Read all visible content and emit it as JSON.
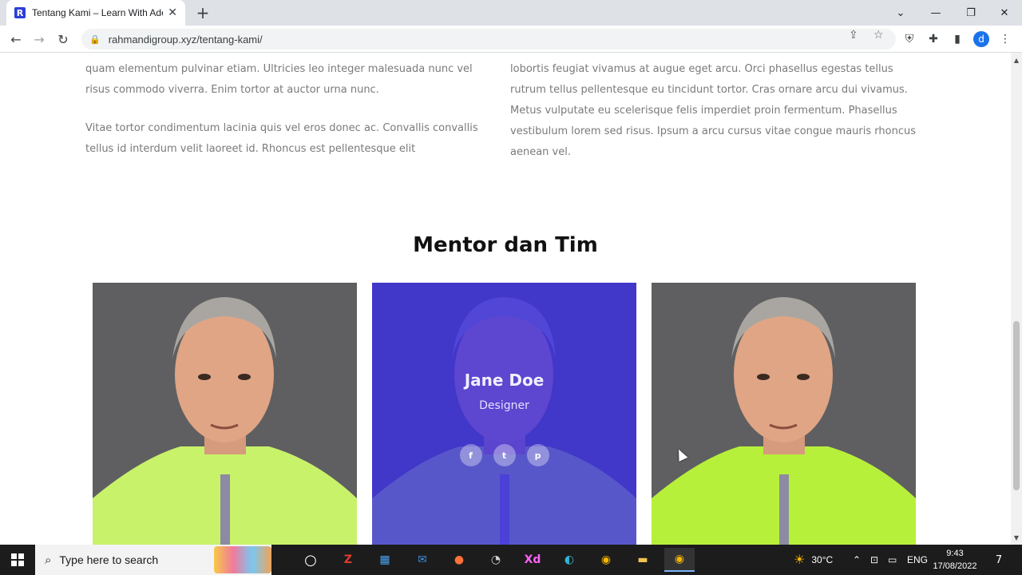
{
  "browser": {
    "tab_title": "Tentang Kami – Learn With Aden",
    "favicon_letter": "R",
    "url": "rahmandigroup.xyz/tentang-kami/",
    "profile_initial": "d"
  },
  "content": {
    "left_paragraphs": [
      "quam elementum pulvinar etiam. Ultricies leo integer malesuada nunc vel risus commodo viverra. Enim tortor at auctor urna nunc.",
      "Vitae tortor condimentum lacinia quis vel eros donec ac. Convallis convallis tellus id interdum velit laoreet id. Rhoncus est pellentesque elit"
    ],
    "right_paragraph": "lobortis feugiat vivamus at augue eget arcu. Orci phasellus egestas tellus rutrum tellus pellentesque eu tincidunt tortor. Cras ornare arcu dui vivamus. Metus vulputate eu scelerisque felis imperdiet proin fermentum. Phasellus vestibulum lorem sed risus. Ipsum a arcu cursus vitae congue mauris rhoncus aenean vel.",
    "section_title": "Mentor dan Tim",
    "team": [
      {
        "name": "",
        "role": ""
      },
      {
        "name": "Jane Doe",
        "role": "Designer",
        "socials": [
          "f",
          "t",
          "p"
        ]
      },
      {
        "name": "",
        "role": ""
      }
    ],
    "overlay_color": "#3a2ce6"
  },
  "taskbar": {
    "search_placeholder": "Type here to search",
    "temperature": "30°C",
    "language": "ENG",
    "time": "9:43",
    "date": "17/08/2022",
    "notification_count": "7"
  }
}
